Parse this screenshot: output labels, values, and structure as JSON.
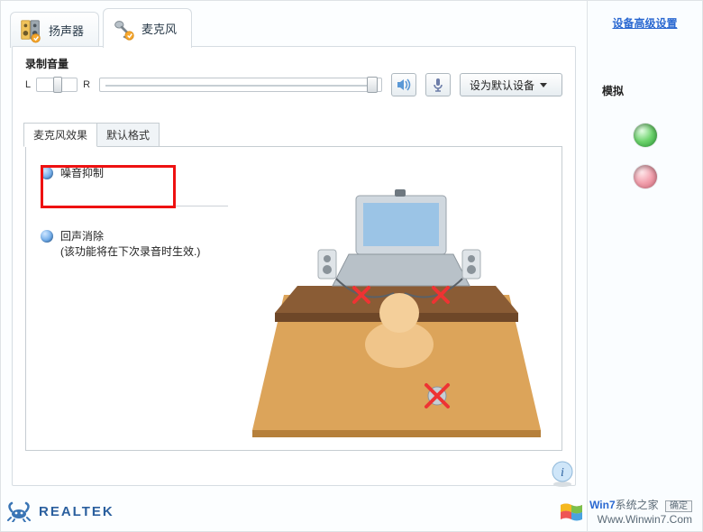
{
  "tabs": {
    "speaker": "扬声器",
    "microphone": "麦克风"
  },
  "side": {
    "advanced_link": "设备高级设置",
    "section": "模拟"
  },
  "volume": {
    "title": "录制音量",
    "balance_left": "L",
    "balance_right": "R",
    "set_default": "设为默认设备"
  },
  "subtabs": {
    "mic_effects": "麦克风效果",
    "default_format": "默认格式"
  },
  "options": {
    "noise_suppression": "噪音抑制",
    "echo_cancel_title": "回声消除",
    "echo_cancel_note": "(该功能将在下次录音时生效.)"
  },
  "brand": "REALTEK",
  "watermark": {
    "line1a": "Win7",
    "line1b": "系统之家",
    "line2": "Www.Winwin7.Com",
    "ok_btn": "确定"
  }
}
